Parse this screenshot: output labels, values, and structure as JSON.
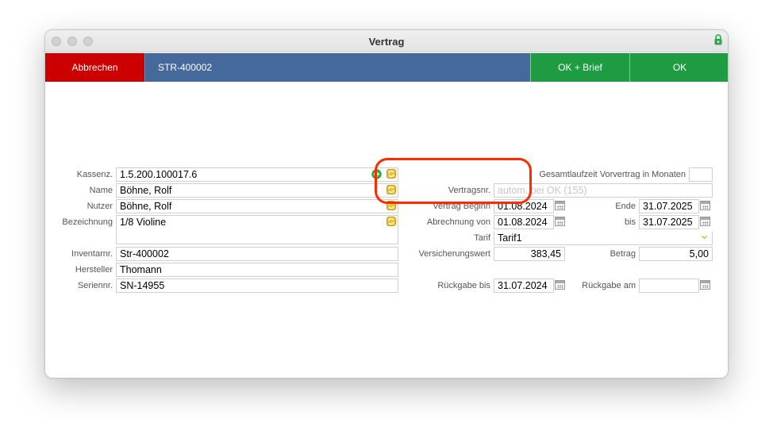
{
  "window": {
    "title": "Vertrag"
  },
  "toolbar": {
    "cancel_label": "Abbrechen",
    "contract_id": "STR-400002",
    "ok_letter_label": "OK + Brief",
    "ok_label": "OK"
  },
  "left": {
    "kassenz_label": "Kassenz.",
    "kassenz_value": "1.5.200.100017.6",
    "name_label": "Name",
    "name_value": "Böhne, Rolf",
    "nutzer_label": "Nutzer",
    "nutzer_value": "Böhne, Rolf",
    "bezeichnung_label": "Bezeichnung",
    "bezeichnung_value": "1/8 Violine",
    "inventarnr_label": "Inventarnr.",
    "inventarnr_value": "Str-400002",
    "hersteller_label": "Hersteller",
    "hersteller_value": "Thomann",
    "seriennr_label": "Seriennr.",
    "seriennr_value": "SN-14955"
  },
  "right": {
    "gesamtlaufzeit_label": "Gesamtlaufzeit Vorvertrag in Monaten",
    "gesamtlaufzeit_value": "",
    "vertragsnr_label": "Vertragsnr.",
    "vertragsnr_placeholder": "autom. bei OK (155)",
    "vertrag_beginn_label": "Vertrag Beginn",
    "vertrag_beginn_value": "01.08.2024",
    "ende_label": "Ende",
    "ende_value": "31.07.2025",
    "abrechnung_von_label": "Abrechnung von",
    "abrechnung_von_value": "01.08.2024",
    "bis_label": "bis",
    "bis_value": "31.07.2025",
    "tarif_label": "Tarif",
    "tarif_value": "Tarif1",
    "versicherungswert_label": "Versicherungswert",
    "versicherungswert_value": "383,45",
    "betrag_label": "Betrag",
    "betrag_value": "5,00",
    "rueckgabe_bis_label": "Rückgabe bis",
    "rueckgabe_bis_value": "31.07.2024",
    "rueckgabe_am_label": "Rückgabe am",
    "rueckgabe_am_value": ""
  },
  "colors": {
    "cancel": "#cc0000",
    "id_bar": "#45699b",
    "ok": "#1f9b43",
    "highlight_circle": "#ff2a00"
  },
  "icons": [
    "lock-icon",
    "add-icon",
    "lookup-icon",
    "calendar-icon",
    "dropdown-chevron-icon"
  ]
}
